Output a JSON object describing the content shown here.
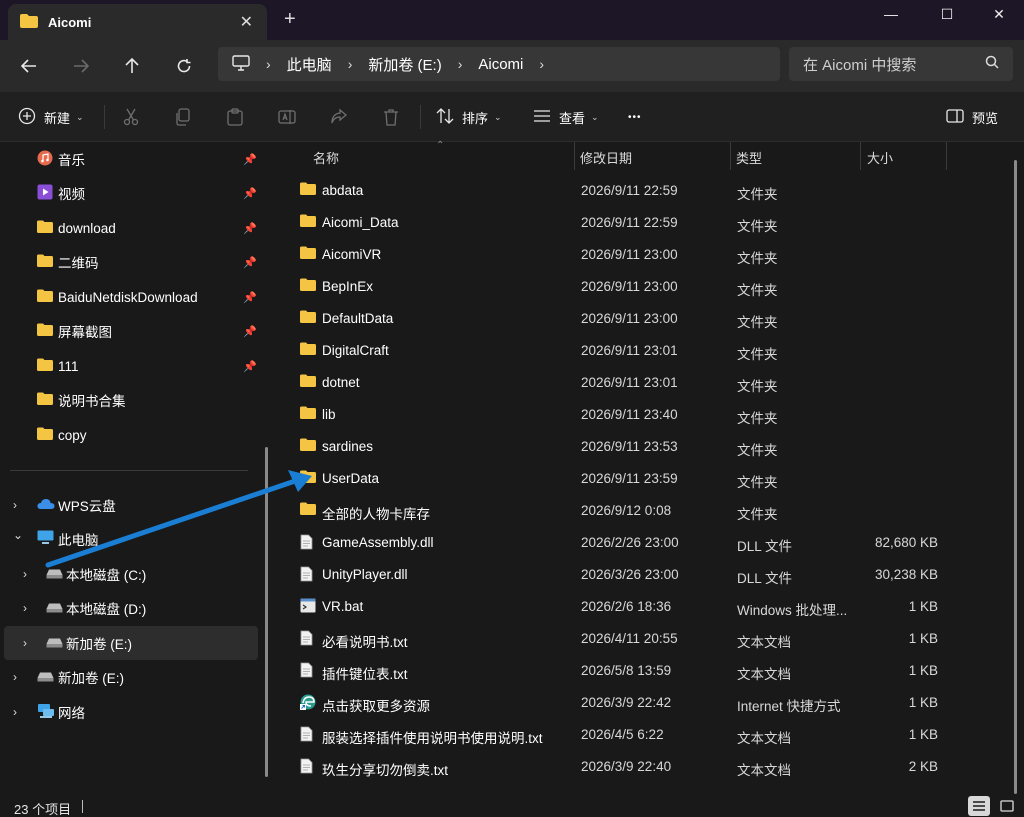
{
  "tab": {
    "title": "Aicomi",
    "close": "✕",
    "new_tab": "+"
  },
  "window": {
    "minimize": "—",
    "maximize": "☐",
    "close": "✕"
  },
  "breadcrumb": {
    "items": [
      "此电脑",
      "新加卷 (E:)",
      "Aicomi"
    ]
  },
  "search": {
    "placeholder": "在 Aicomi 中搜索"
  },
  "toolbar": {
    "new_label": "新建",
    "sort_label": "排序",
    "view_label": "查看",
    "more_label": "•••",
    "preview_label": "预览"
  },
  "sidebar": {
    "quick": [
      {
        "label": "音乐",
        "icon": "music-icon",
        "pinned": true
      },
      {
        "label": "视频",
        "icon": "video-icon",
        "pinned": true
      },
      {
        "label": "download",
        "icon": "folder-icon",
        "pinned": true
      },
      {
        "label": "二维码",
        "icon": "folder-icon",
        "pinned": true
      },
      {
        "label": "BaiduNetdiskDownload",
        "icon": "folder-icon",
        "pinned": true
      },
      {
        "label": "屏幕截图",
        "icon": "folder-icon",
        "pinned": true
      },
      {
        "label": "111",
        "icon": "folder-icon",
        "pinned": true
      },
      {
        "label": "说明书合集",
        "icon": "folder-icon",
        "pinned": false
      },
      {
        "label": "copy",
        "icon": "folder-icon",
        "pinned": false
      }
    ],
    "tree": [
      {
        "label": "WPS云盘",
        "icon": "cloud-icon",
        "expander": "›"
      },
      {
        "label": "此电脑",
        "icon": "pc-icon",
        "expander": "⌄"
      },
      {
        "label": "本地磁盘 (C:)",
        "icon": "drive-icon",
        "expander": "›"
      },
      {
        "label": "本地磁盘 (D:)",
        "icon": "drive-icon",
        "expander": "›"
      },
      {
        "label": "新加卷 (E:)",
        "icon": "drive-icon",
        "expander": "›"
      },
      {
        "label": "新加卷 (E:)",
        "icon": "drive-icon",
        "expander": "›"
      },
      {
        "label": "网络",
        "icon": "network-icon",
        "expander": "›"
      }
    ]
  },
  "columns": {
    "name": "名称",
    "date": "修改日期",
    "type": "类型",
    "size": "大小"
  },
  "files": [
    {
      "name": "abdata",
      "date": "2026/9/11 22:59",
      "type": "文件夹",
      "size": "",
      "icon": "folder-icon"
    },
    {
      "name": "Aicomi_Data",
      "date": "2026/9/11 22:59",
      "type": "文件夹",
      "size": "",
      "icon": "folder-icon"
    },
    {
      "name": "AicomiVR",
      "date": "2026/9/11 23:00",
      "type": "文件夹",
      "size": "",
      "icon": "folder-icon"
    },
    {
      "name": "BepInEx",
      "date": "2026/9/11 23:00",
      "type": "文件夹",
      "size": "",
      "icon": "folder-icon"
    },
    {
      "name": "DefaultData",
      "date": "2026/9/11 23:00",
      "type": "文件夹",
      "size": "",
      "icon": "folder-icon"
    },
    {
      "name": "DigitalCraft",
      "date": "2026/9/11 23:01",
      "type": "文件夹",
      "size": "",
      "icon": "folder-icon"
    },
    {
      "name": "dotnet",
      "date": "2026/9/11 23:01",
      "type": "文件夹",
      "size": "",
      "icon": "folder-icon"
    },
    {
      "name": "lib",
      "date": "2026/9/11 23:40",
      "type": "文件夹",
      "size": "",
      "icon": "folder-icon"
    },
    {
      "name": "sardines",
      "date": "2026/9/11 23:53",
      "type": "文件夹",
      "size": "",
      "icon": "folder-icon"
    },
    {
      "name": "UserData",
      "date": "2026/9/11 23:59",
      "type": "文件夹",
      "size": "",
      "icon": "folder-icon"
    },
    {
      "name": "全部的人物卡库存",
      "date": "2026/9/12 0:08",
      "type": "文件夹",
      "size": "",
      "icon": "folder-icon"
    },
    {
      "name": "GameAssembly.dll",
      "date": "2026/2/26 23:00",
      "type": "DLL 文件",
      "size": "82,680 KB",
      "icon": "file-icon"
    },
    {
      "name": "UnityPlayer.dll",
      "date": "2026/3/26 23:00",
      "type": "DLL 文件",
      "size": "30,238 KB",
      "icon": "file-icon"
    },
    {
      "name": "VR.bat",
      "date": "2026/2/6 18:36",
      "type": "Windows 批处理...",
      "size": "1 KB",
      "icon": "bat-icon"
    },
    {
      "name": "必看说明书.txt",
      "date": "2026/4/11 20:55",
      "type": "文本文档",
      "size": "1 KB",
      "icon": "file-icon"
    },
    {
      "name": "插件键位表.txt",
      "date": "2026/5/8 13:59",
      "type": "文本文档",
      "size": "1 KB",
      "icon": "file-icon"
    },
    {
      "name": "点击获取更多资源",
      "date": "2026/3/9 22:42",
      "type": "Internet 快捷方式",
      "size": "1 KB",
      "icon": "edge-shortcut-icon"
    },
    {
      "name": "服装选择插件使用说明书使用说明.txt",
      "date": "2026/4/5 6:22",
      "type": "文本文档",
      "size": "1 KB",
      "icon": "file-icon"
    },
    {
      "name": "玖生分享切勿倒卖.txt",
      "date": "2026/3/9 22:40",
      "type": "文本文档",
      "size": "2 KB",
      "icon": "file-icon"
    }
  ],
  "status": {
    "count": "23 个项目"
  },
  "colors": {
    "folder": "#f4c542",
    "accent_arrow": "#1a7fd4",
    "background": "#191919",
    "selected": "#2d2d2d"
  }
}
